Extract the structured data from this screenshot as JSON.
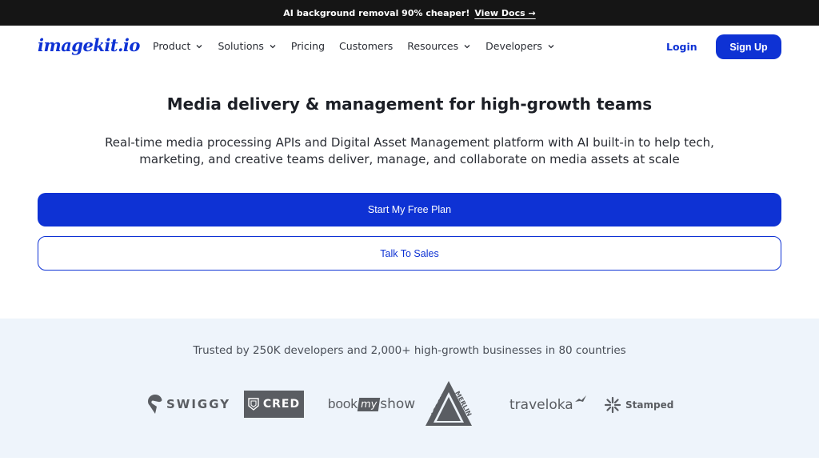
{
  "announcement": {
    "text": "AI background removal 90% cheaper!",
    "link": "View Docs →"
  },
  "nav": {
    "logo": "imagekit.io",
    "items": [
      {
        "label": "Product",
        "has_dropdown": true
      },
      {
        "label": "Solutions",
        "has_dropdown": true
      },
      {
        "label": "Pricing",
        "has_dropdown": false
      },
      {
        "label": "Customers",
        "has_dropdown": false
      },
      {
        "label": "Resources",
        "has_dropdown": true
      },
      {
        "label": "Developers",
        "has_dropdown": true
      }
    ],
    "login": "Login",
    "signup": "Sign Up"
  },
  "hero": {
    "headline": "Media delivery & management for high-growth teams",
    "subtext": "Real-time media processing APIs and Digital Asset Management platform with AI built-in to help tech, marketing, and creative teams deliver, manage, and collaborate on media assets at scale",
    "primary_cta": "Start My Free Plan",
    "secondary_cta": "Talk To Sales"
  },
  "trusted": {
    "text": "Trusted by 250K developers and 2,000+ high-growth businesses in 80 countries",
    "logos": {
      "swiggy": "SWIGGY",
      "cred": "CRED",
      "bookmyshow_book": "book",
      "bookmyshow_my": "my",
      "bookmyshow_show": "show",
      "leroy": "LEROY",
      "merlin": "MERLIN",
      "traveloka": "traveloka",
      "stamped": "Stamped"
    }
  },
  "colors": {
    "brand": "#0e32d4",
    "announce_bg": "#151515",
    "trusted_bg": "#eef4fb",
    "logo_gray": "#5a5d62"
  }
}
